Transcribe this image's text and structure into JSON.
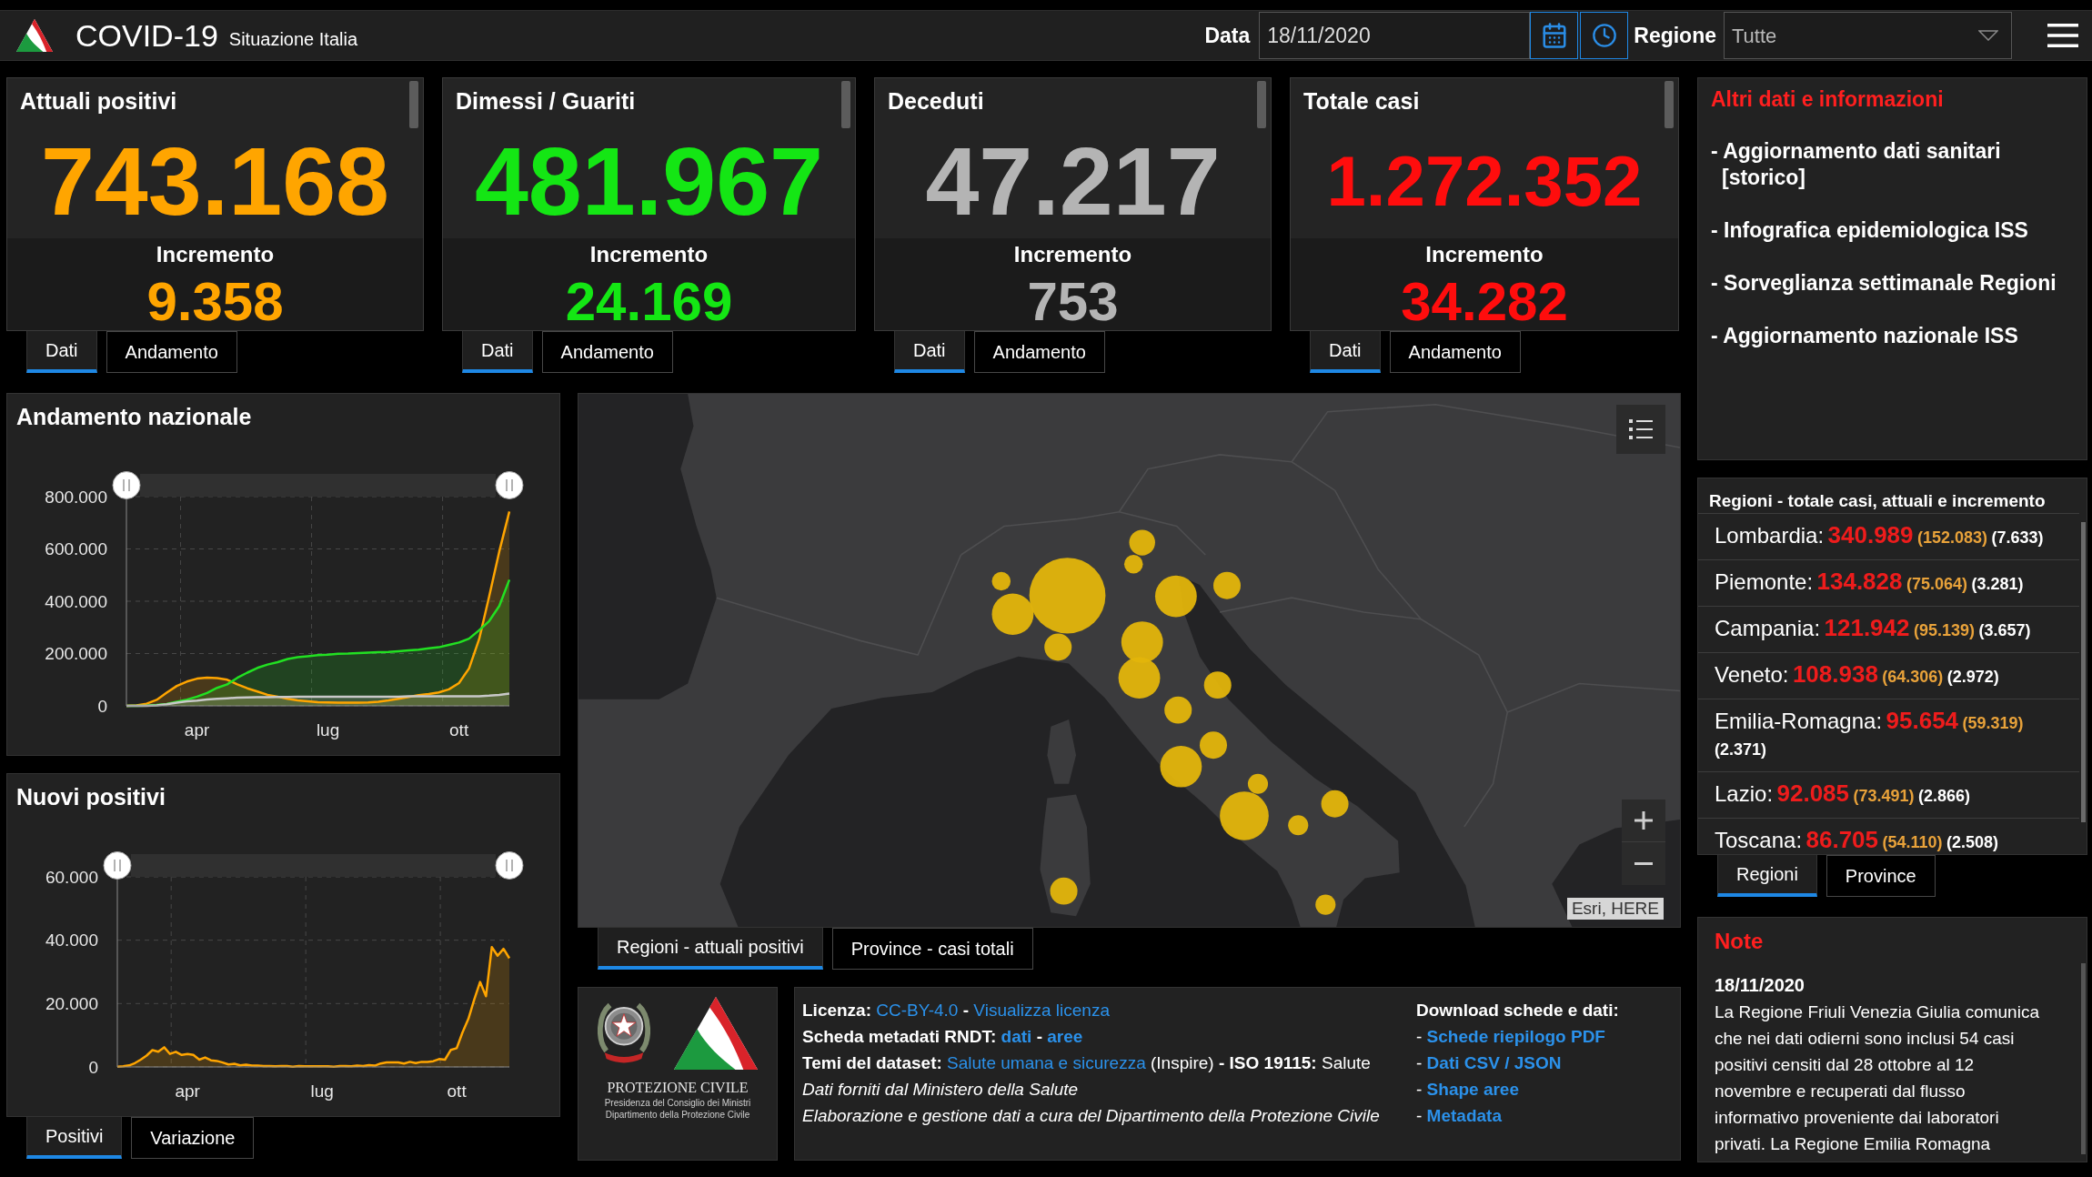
{
  "header": {
    "title": "COVID-19",
    "subtitle": "Situazione Italia",
    "date_label": "Data",
    "date_value": "18/11/2020",
    "region_label": "Regione",
    "region_value": "Tutte"
  },
  "cards": [
    {
      "title": "Attuali positivi",
      "value": "743.168",
      "increment_label": "Incremento",
      "increment": "9.358",
      "color": "#ffa500",
      "tabs": [
        {
          "label": "Dati",
          "selected": true
        },
        {
          "label": "Andamento",
          "selected": false
        }
      ]
    },
    {
      "title": "Dimessi / Guariti",
      "value": "481.967",
      "increment_label": "Incremento",
      "increment": "24.169",
      "color": "#14e614",
      "tabs": [
        {
          "label": "Dati",
          "selected": true
        },
        {
          "label": "Andamento",
          "selected": false
        }
      ]
    },
    {
      "title": "Deceduti",
      "value": "47.217",
      "increment_label": "Incremento",
      "increment": "753",
      "color": "#b4b4b4",
      "tabs": [
        {
          "label": "Dati",
          "selected": true
        },
        {
          "label": "Andamento",
          "selected": false
        }
      ]
    },
    {
      "title": "Totale casi",
      "value": "1.272.352",
      "increment_label": "Incremento",
      "increment": "34.282",
      "color": "#ff0d0d",
      "tabs": [
        {
          "label": "Dati",
          "selected": true
        },
        {
          "label": "Andamento",
          "selected": false
        }
      ]
    }
  ],
  "info_panel": {
    "title": "Altri dati e informazioni",
    "links": [
      "- Aggiornamento dati sanitari [storico]",
      "- Infografica epidemiologica ISS",
      "- Sorveglianza settimanale Regioni",
      "- Aggiornamento nazionale ISS"
    ]
  },
  "charts": [
    {
      "title": "Andamento nazionale",
      "chart_data": {
        "type": "area",
        "grid": true,
        "categories": [
          null,
          null,
          null,
          null,
          null,
          null,
          null,
          "apr",
          null,
          null,
          null,
          null,
          null,
          null,
          null,
          null,
          null,
          null,
          null,
          null,
          "lug",
          null,
          null,
          null,
          null,
          null,
          null,
          null,
          null,
          null,
          null,
          null,
          null,
          "ott",
          null,
          null,
          null,
          null,
          null
        ],
        "series": [
          {
            "color": "#ffa500",
            "values": [
              0,
              2,
              8,
              23,
              50,
              76,
              93,
              104,
              108,
              106,
              100,
              82,
              67,
              55,
              42,
              35,
              27,
              21,
              17,
              14,
              13,
              12,
              12,
              12,
              13,
              16,
              21,
              27,
              34,
              41,
              45,
              51,
              63,
              87,
              143,
              255,
              418,
              590,
              743
            ]
          },
          {
            "color": "#22e022",
            "values": [
              0,
              0,
              1,
              3,
              7,
              16,
              24,
              35,
              49,
              69,
              82,
              107,
              127,
              145,
              158,
              167,
              179,
              186,
              190,
              194,
              196,
              199,
              200,
              202,
              203,
              205,
              206,
              209,
              212,
              215,
              220,
              224,
              233,
              242,
              257,
              289,
              324,
              382,
              482
            ]
          },
          {
            "color": "#c8c8c8",
            "values": [
              0,
              0,
              0,
              2,
              6,
              12,
              17,
              20,
              24,
              27,
              29,
              31,
              32,
              33,
              33,
              34,
              34,
              35,
              35,
              35,
              35,
              35,
              35,
              35,
              35,
              35,
              35,
              35,
              36,
              36,
              36,
              36,
              36,
              36,
              37,
              37,
              39,
              42,
              47
            ]
          }
        ],
        "ylim": [
          0,
          800
        ],
        "yticks": [
          {
            "value": 0,
            "label": "0"
          },
          {
            "value": 200,
            "label": "200.000"
          },
          {
            "value": 400,
            "label": "400.000"
          },
          {
            "value": 600,
            "label": "600.000"
          },
          {
            "value": 800,
            "label": "800.000"
          }
        ]
      }
    },
    {
      "title": "Nuovi positivi",
      "chart_data": {
        "type": "area",
        "grid": true,
        "categories": [
          null,
          null,
          null,
          null,
          null,
          null,
          null,
          null,
          null,
          null,
          null,
          null,
          "apr",
          null,
          null,
          null,
          null,
          null,
          null,
          null,
          null,
          null,
          null,
          null,
          null,
          null,
          null,
          null,
          null,
          null,
          null,
          null,
          null,
          null,
          null,
          "lug",
          null,
          null,
          null,
          null,
          null,
          null,
          null,
          null,
          null,
          null,
          null,
          null,
          null,
          null,
          null,
          null,
          null,
          null,
          null,
          null,
          null,
          null,
          "ott",
          null,
          null,
          null,
          null,
          null,
          null,
          null,
          null,
          null
        ],
        "series": [
          {
            "color": "#ffa500",
            "values": [
              0.1,
              0.2,
              0.5,
              1.2,
              2.3,
              3.6,
              5.3,
              4.8,
              6.2,
              4.1,
              4.8,
              3.8,
              4.1,
              3.8,
              2.3,
              3.0,
              2.1,
              1.9,
              1.4,
              0.8,
              1.0,
              0.5,
              0.7,
              0.4,
              0.4,
              0.3,
              0.3,
              0.2,
              0.3,
              0.3,
              0.1,
              0.3,
              0.2,
              0.2,
              0.2,
              0.2,
              0.2,
              0.1,
              0.3,
              0.3,
              0.2,
              0.4,
              0.3,
              0.6,
              0.4,
              1.1,
              1.4,
              1.4,
              1.4,
              1.1,
              1.6,
              1.2,
              1.6,
              1.6,
              1.8,
              2.5,
              2.3,
              5.4,
              5.9,
              10.9,
              15.2,
              21.3,
              26.8,
              22.3,
              37.8,
              35.1,
              37.3,
              34.3
            ]
          }
        ],
        "ylim": [
          0,
          60
        ],
        "yticks": [
          {
            "value": 0,
            "label": "0"
          },
          {
            "value": 20,
            "label": "20.000"
          },
          {
            "value": 40,
            "label": "40.000"
          },
          {
            "value": 60,
            "label": "60.000"
          }
        ]
      },
      "tabs": [
        {
          "label": "Positivi",
          "selected": true
        },
        {
          "label": "Variazione",
          "selected": false
        }
      ]
    }
  ],
  "map": {
    "attribution": "Esri, HERE",
    "tabs": [
      {
        "label": "Regioni - attuali positivi",
        "selected": true
      },
      {
        "label": "Province - casi totali",
        "selected": false
      }
    ]
  },
  "regions_panel": {
    "title": "Regioni - totale casi, attuali e incremento",
    "rows": [
      {
        "name": "Lombardia:",
        "total": "340.989",
        "active": "(152.083)",
        "increase": "(7.633)"
      },
      {
        "name": "Piemonte:",
        "total": "134.828",
        "active": "(75.064)",
        "increase": "(3.281)"
      },
      {
        "name": "Campania:",
        "total": "121.942",
        "active": "(95.139)",
        "increase": "(3.657)"
      },
      {
        "name": "Veneto:",
        "total": "108.938",
        "active": "(64.306)",
        "increase": "(2.972)"
      },
      {
        "name": "Emilia-Romagna:",
        "total": "95.654",
        "active": "(59.319)",
        "increase": "(2.371)"
      },
      {
        "name": "Lazio:",
        "total": "92.085",
        "active": "(73.491)",
        "increase": "(2.866)"
      },
      {
        "name": "Toscana:",
        "total": "86.705",
        "active": "(54.110)",
        "increase": "(2.508)"
      }
    ],
    "tabs": [
      {
        "label": "Regioni",
        "selected": true
      },
      {
        "label": "Province",
        "selected": false
      }
    ]
  },
  "footer": {
    "logo": {
      "title": "PROTEZIONE CIVILE",
      "subtitle_lines": [
        "Presidenza del Consiglio dei Ministri",
        "Dipartimento della Protezione Civile"
      ]
    },
    "info": {
      "lines": [
        {
          "segments": [
            {
              "kind": "label",
              "text": "Licenza:"
            },
            {
              "kind": "link",
              "text": "CC-BY-4.0"
            },
            {
              "kind": "label",
              "text": "-"
            },
            {
              "kind": "link",
              "text": "Visualizza licenza"
            }
          ]
        },
        {
          "segments": [
            {
              "kind": "label",
              "text": "Scheda metadati RNDT:"
            },
            {
              "kind": "strong_link",
              "text": "dati"
            },
            {
              "kind": "label",
              "text": "-"
            },
            {
              "kind": "strong_link",
              "text": "aree"
            }
          ]
        },
        {
          "segments": [
            {
              "kind": "label",
              "text": "Temi del dataset:"
            },
            {
              "kind": "link",
              "text": "Salute umana e sicurezza"
            },
            {
              "kind": "text",
              "text": "(Inspire)"
            },
            {
              "kind": "label",
              "text": "- ISO 19115:"
            },
            {
              "kind": "text",
              "text": "Salute"
            }
          ]
        },
        {
          "segments": [
            {
              "kind": "note",
              "text": "Dati forniti dal Ministero della Salute"
            }
          ]
        },
        {
          "segments": [
            {
              "kind": "note",
              "text": "Elaborazione e gestione dati a cura del Dipartimento della Protezione Civile"
            }
          ]
        }
      ]
    },
    "downloads": {
      "title": "Download schede e dati:",
      "links": [
        {
          "bullet": "-",
          "text": "Schede riepilogo PDF"
        },
        {
          "bullet": "-",
          "text": "Dati CSV / JSON"
        },
        {
          "bullet": "-",
          "text": "Shape aree"
        },
        {
          "bullet": "-",
          "text": "Metadata"
        }
      ]
    }
  },
  "note": {
    "title": "Note",
    "date": "18/11/2020",
    "text": "La Regione Friuli Venezia Giulia comunica\nche nei dati odierni sono inclusi 54 casi\npositivi censiti dal 28 ottobre al 12\nnovembre e recuperati dal flusso\ninformativo proveniente dai laboratori\nprivati. La Regione Emilia Romagna"
  }
}
